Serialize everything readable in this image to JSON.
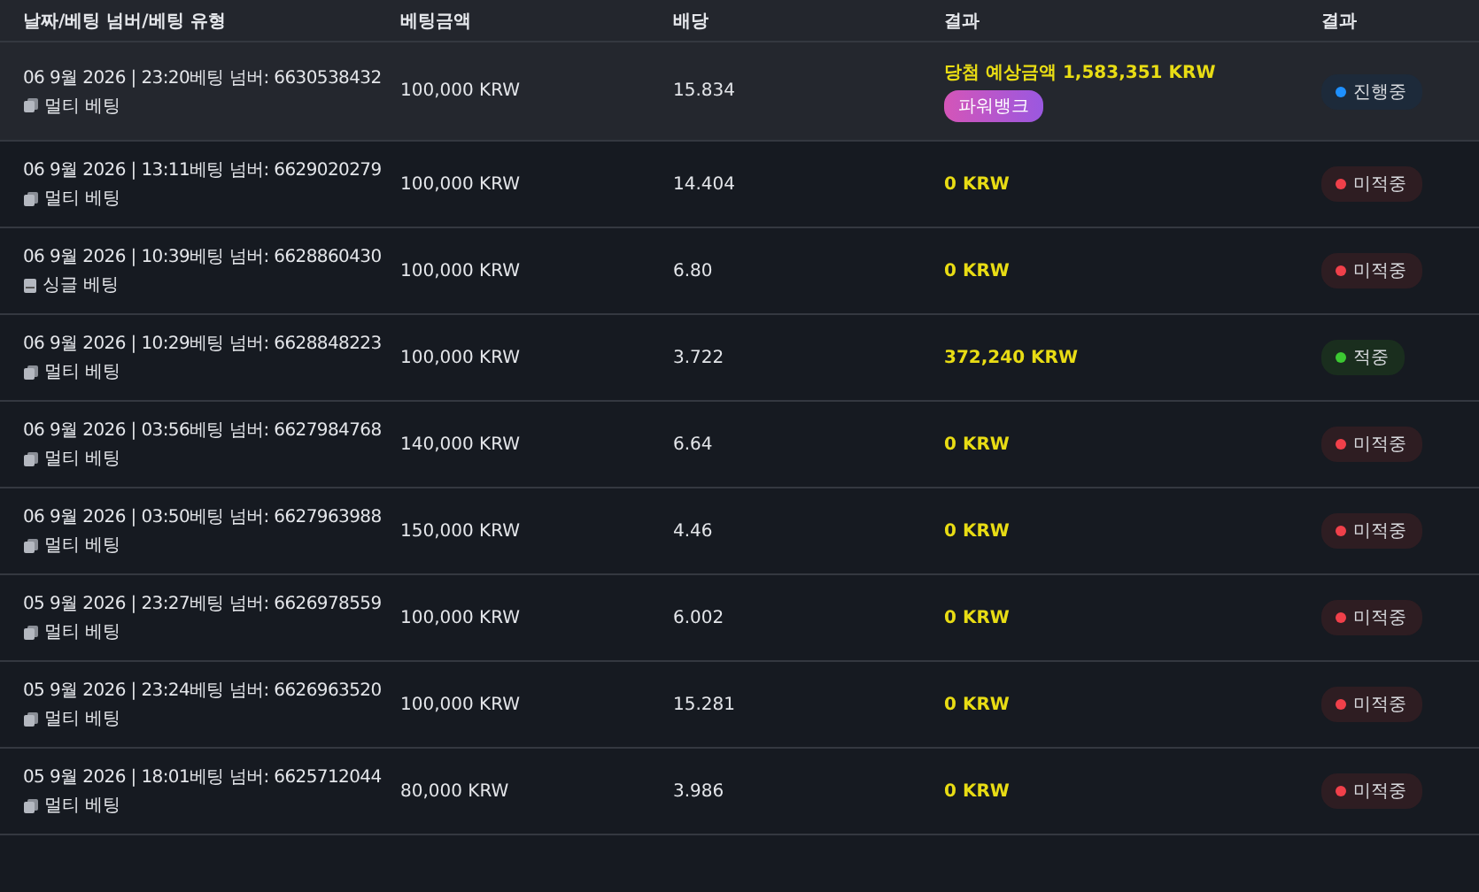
{
  "table": {
    "columns": [
      "날짜/베팅 넘버/베팅 유형",
      "베팅금액",
      "배당",
      "결과",
      "결과"
    ],
    "rows": [
      {
        "selected": true,
        "datetime": "06 9월 2026 | 23:20베팅 넘버: 6630538432",
        "bet_type": {
          "kind": "multi",
          "label": "멀티 베팅"
        },
        "amount": "100,000 KRW",
        "odds": "15.834",
        "result": "당첨 예상금액 1,583,351 KRW",
        "tag": "파워뱅크",
        "status": {
          "kind": "progress",
          "label": "진행중",
          "color": "#1e90ff"
        }
      },
      {
        "selected": false,
        "datetime": "06 9월 2026 | 13:11베팅 넘버: 6629020279",
        "bet_type": {
          "kind": "multi",
          "label": "멀티 베팅"
        },
        "amount": "100,000 KRW",
        "odds": "14.404",
        "result": "0 KRW",
        "status": {
          "kind": "lose",
          "label": "미적중",
          "color": "#f0404a"
        }
      },
      {
        "selected": false,
        "datetime": "06 9월 2026 | 10:39베팅 넘버: 6628860430",
        "bet_type": {
          "kind": "single",
          "label": "싱글 베팅"
        },
        "amount": "100,000 KRW",
        "odds": "6.80",
        "result": "0 KRW",
        "status": {
          "kind": "lose",
          "label": "미적중",
          "color": "#f0404a"
        }
      },
      {
        "selected": false,
        "datetime": "06 9월 2026 | 10:29베팅 넘버: 6628848223",
        "bet_type": {
          "kind": "multi",
          "label": "멀티 베팅"
        },
        "amount": "100,000 KRW",
        "odds": "3.722",
        "result": "372,240 KRW",
        "status": {
          "kind": "win",
          "label": "적중",
          "color": "#3cc832"
        }
      },
      {
        "selected": false,
        "datetime": "06 9월 2026 | 03:56베팅 넘버: 6627984768",
        "bet_type": {
          "kind": "multi",
          "label": "멀티 베팅"
        },
        "amount": "140,000 KRW",
        "odds": "6.64",
        "result": "0 KRW",
        "status": {
          "kind": "lose",
          "label": "미적중",
          "color": "#f0404a"
        }
      },
      {
        "selected": false,
        "datetime": "06 9월 2026 | 03:50베팅 넘버: 6627963988",
        "bet_type": {
          "kind": "multi",
          "label": "멀티 베팅"
        },
        "amount": "150,000 KRW",
        "odds": "4.46",
        "result": "0 KRW",
        "status": {
          "kind": "lose",
          "label": "미적중",
          "color": "#f0404a"
        }
      },
      {
        "selected": false,
        "datetime": "05 9월 2026 | 23:27베팅 넘버: 6626978559",
        "bet_type": {
          "kind": "multi",
          "label": "멀티 베팅"
        },
        "amount": "100,000 KRW",
        "odds": "6.002",
        "result": "0 KRW",
        "status": {
          "kind": "lose",
          "label": "미적중",
          "color": "#f0404a"
        }
      },
      {
        "selected": false,
        "datetime": "05 9월 2026 | 23:24베팅 넘버: 6626963520",
        "bet_type": {
          "kind": "multi",
          "label": "멀티 베팅"
        },
        "amount": "100,000 KRW",
        "odds": "15.281",
        "result": "0 KRW",
        "status": {
          "kind": "lose",
          "label": "미적중",
          "color": "#f0404a"
        }
      },
      {
        "selected": false,
        "datetime": "05 9월 2026 | 18:01베팅 넘버: 6625712044",
        "bet_type": {
          "kind": "multi",
          "label": "멀티 베팅"
        },
        "amount": "80,000 KRW",
        "odds": "3.986",
        "result": "0 KRW",
        "status": {
          "kind": "lose",
          "label": "미적중",
          "color": "#f0404a"
        }
      }
    ]
  }
}
